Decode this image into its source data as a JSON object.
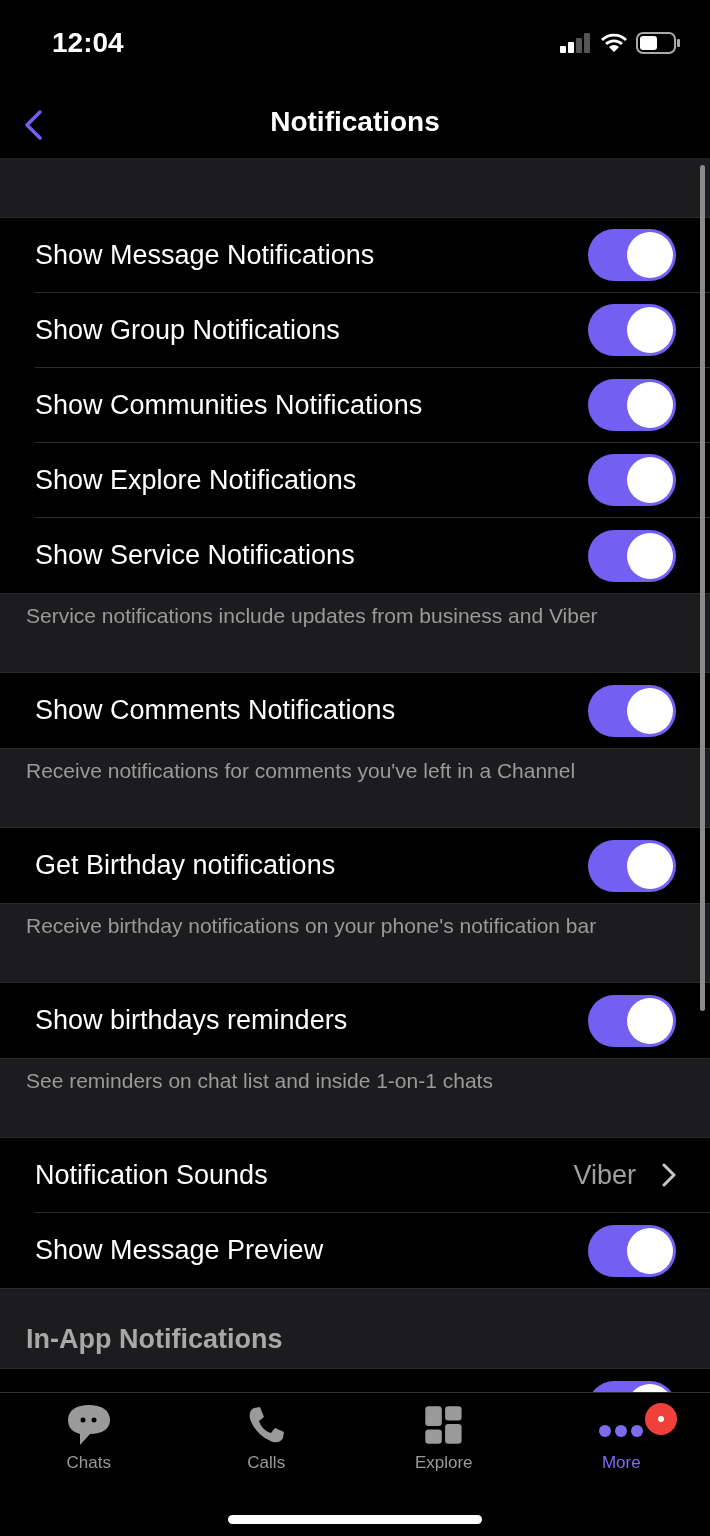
{
  "status_bar": {
    "time": "12:04"
  },
  "nav": {
    "title": "Notifications"
  },
  "groups": [
    {
      "rows": [
        {
          "kind": "toggle",
          "label": "Show Message Notifications",
          "on": true
        },
        {
          "kind": "toggle",
          "label": "Show Group Notifications",
          "on": true
        },
        {
          "kind": "toggle",
          "label": "Show Communities Notifications",
          "on": true
        },
        {
          "kind": "toggle",
          "label": "Show Explore Notifications",
          "on": true
        },
        {
          "kind": "toggle",
          "label": "Show Service Notifications",
          "on": true
        }
      ],
      "footer": "Service notifications include updates from business and Viber"
    },
    {
      "rows": [
        {
          "kind": "toggle",
          "label": "Show Comments Notifications",
          "on": true
        }
      ],
      "footer": "Receive notifications for comments you've left in a Channel"
    },
    {
      "rows": [
        {
          "kind": "toggle",
          "label": "Get Birthday notifications",
          "on": true
        }
      ],
      "footer": "Receive birthday notifications on your phone's notification bar"
    },
    {
      "rows": [
        {
          "kind": "toggle",
          "label": "Show birthdays reminders",
          "on": true
        }
      ],
      "footer": "See reminders on chat list and inside 1-on-1 chats"
    },
    {
      "rows": [
        {
          "kind": "link",
          "label": "Notification Sounds",
          "value": "Viber"
        },
        {
          "kind": "toggle",
          "label": "Show Message Preview",
          "on": true
        }
      ]
    },
    {
      "header": "In-App Notifications",
      "rows": [
        {
          "kind": "toggle",
          "on": true
        }
      ]
    }
  ],
  "tabs": [
    {
      "kind": "chats",
      "label": "Chats",
      "selected": false
    },
    {
      "kind": "calls",
      "label": "Calls",
      "selected": false
    },
    {
      "kind": "explore",
      "label": "Explore",
      "selected": false
    },
    {
      "kind": "more",
      "label": "More",
      "selected": true,
      "badge": true
    }
  ]
}
